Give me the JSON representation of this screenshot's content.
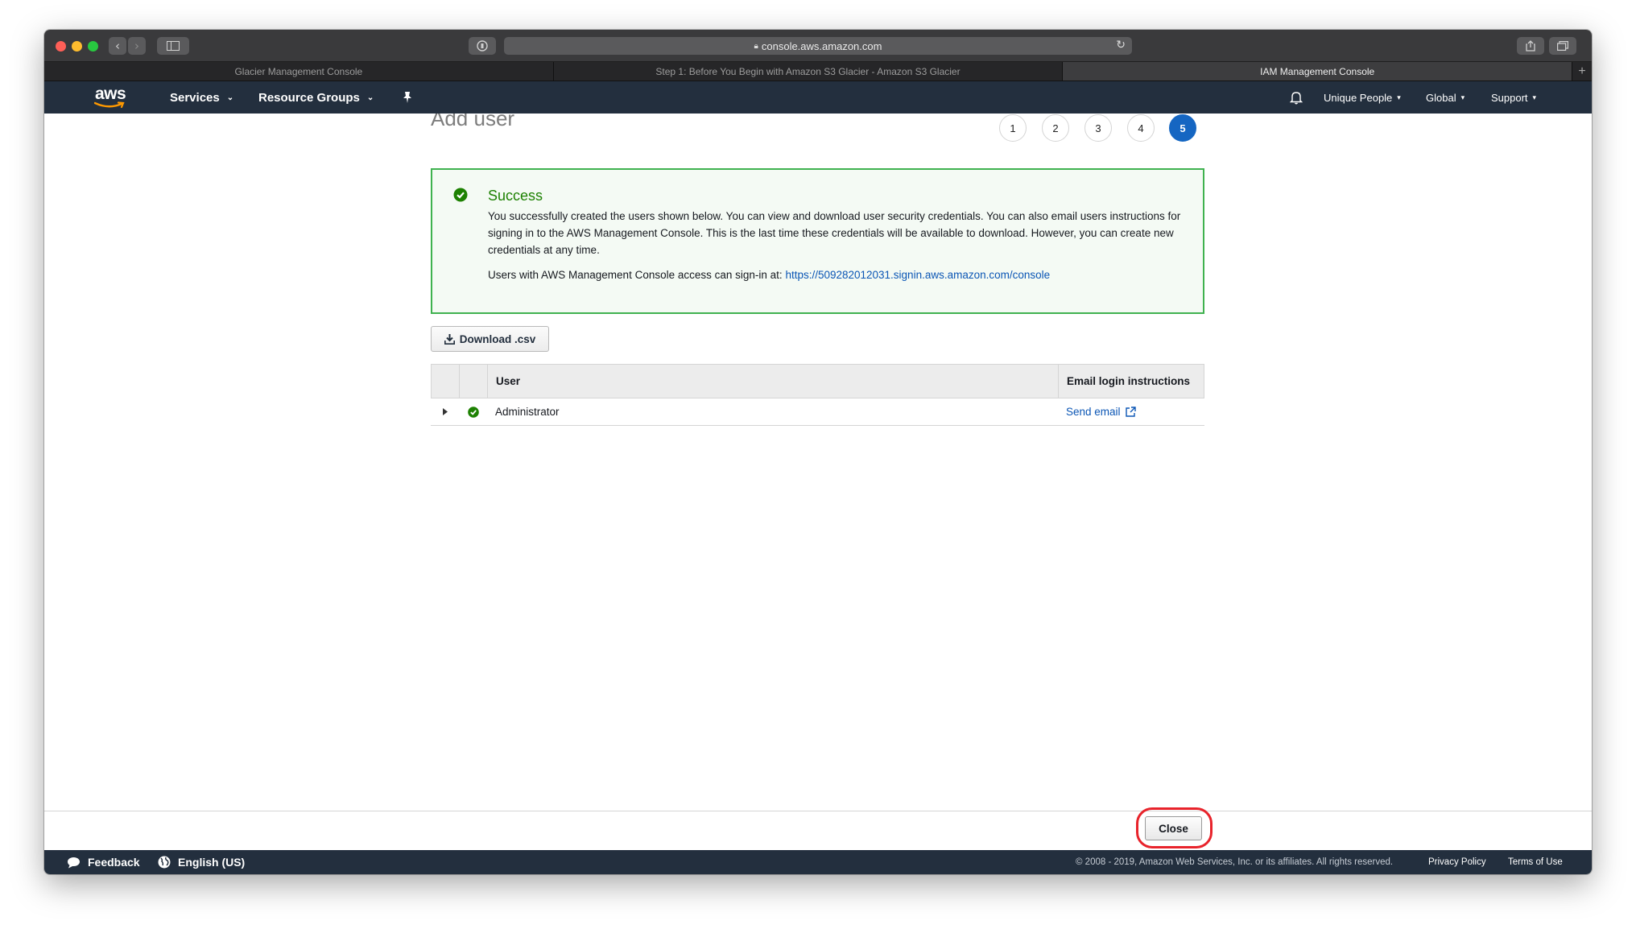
{
  "browser": {
    "url": "console.aws.amazon.com",
    "tabs": [
      {
        "label": "Glacier Management Console",
        "active": false
      },
      {
        "label": "Step 1: Before You Begin with Amazon S3 Glacier - Amazon S3 Glacier",
        "active": false
      },
      {
        "label": "IAM Management Console",
        "active": true
      }
    ]
  },
  "aws_nav": {
    "logo": "aws",
    "services": "Services",
    "resource_groups": "Resource Groups",
    "account": "Unique People",
    "region": "Global",
    "support": "Support"
  },
  "page": {
    "title": "Add user",
    "steps": [
      "1",
      "2",
      "3",
      "4",
      "5"
    ],
    "active_step": "5"
  },
  "alert": {
    "heading": "Success",
    "body": "You successfully created the users shown below. You can view and download user security credentials. You can also email users instructions for signing in to the AWS Management Console. This is the last time these credentials will be available to download. However, you can create new credentials at any time.",
    "signin_prefix": "Users with AWS Management Console access can sign-in at:",
    "signin_url": "https://509282012031.signin.aws.amazon.com/console"
  },
  "download_button": "Download .csv",
  "table": {
    "columns": [
      "User",
      "Email login instructions"
    ],
    "rows": [
      {
        "user": "Administrator",
        "email_action": "Send email"
      }
    ]
  },
  "close_button": "Close",
  "footer": {
    "feedback": "Feedback",
    "language": "English (US)",
    "copyright": "© 2008 - 2019, Amazon Web Services, Inc. or its affiliates. All rights reserved.",
    "privacy": "Privacy Policy",
    "terms": "Terms of Use"
  },
  "colors": {
    "aws_nav_bg": "#232f3e",
    "success_green": "#1d8102",
    "link_blue": "#0b56b5",
    "active_step": "#1566c2",
    "highlight_red": "#e8232b"
  }
}
